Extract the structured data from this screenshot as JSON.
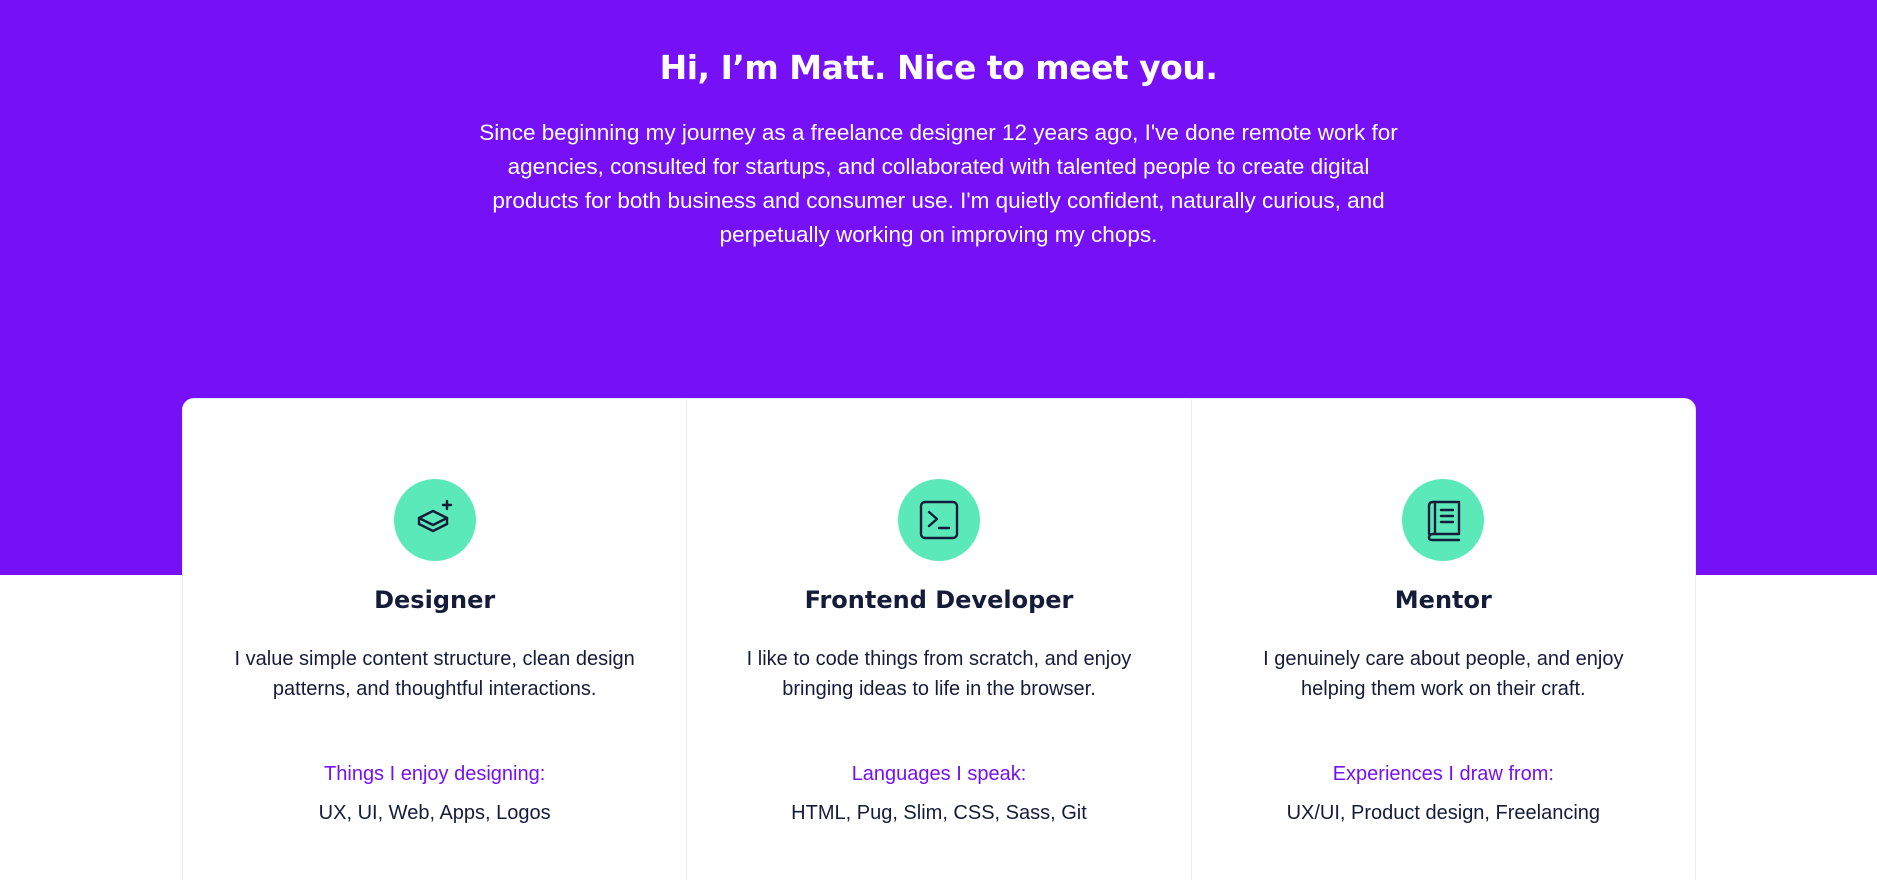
{
  "hero": {
    "title": "Hi, I’m Matt. Nice to meet you.",
    "text": "Since beginning my journey as a freelance designer 12 years ago, I've done remote work for agencies, consulted for startups, and collaborated with talented people to create digital products for both business and consumer use. I'm quietly confident, naturally curious, and perpetually working on improving my chops."
  },
  "colors": {
    "brand_purple": "#7510f7",
    "icon_green": "#5be9b9",
    "text_dark": "#141c3a",
    "card_border": "#e6ecf8"
  },
  "skills": [
    {
      "icon": "layers-plus-icon",
      "title": "Designer",
      "description": "I value simple content structure, clean design patterns, and thoughtful interactions.",
      "subheading": "Things I enjoy designing:",
      "list": "UX, UI, Web, Apps, Logos"
    },
    {
      "icon": "terminal-icon",
      "title": "Frontend Developer",
      "description": "I like to code things from scratch, and enjoy bringing ideas to life in the browser.",
      "subheading": "Languages I speak:",
      "list": "HTML, Pug, Slim, CSS, Sass, Git"
    },
    {
      "icon": "book-icon",
      "title": "Mentor",
      "description": "I genuinely care about people, and enjoy helping them work on their craft.",
      "subheading": "Experiences I draw from:",
      "list": "UX/UI, Product design, Freelancing"
    }
  ]
}
